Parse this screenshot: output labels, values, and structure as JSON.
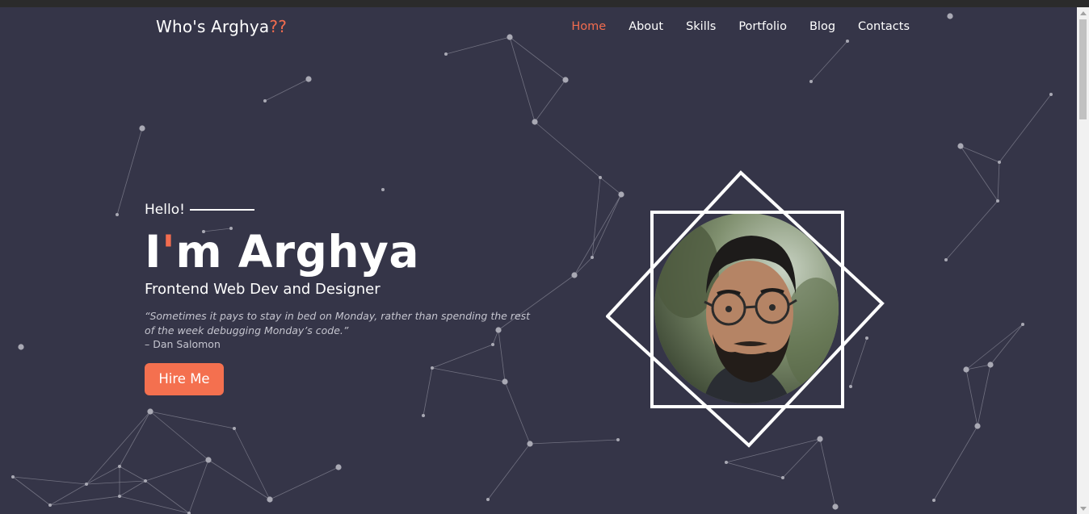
{
  "brand": {
    "name": "Who's Arghya",
    "accent": "??"
  },
  "nav": {
    "items": [
      {
        "label": "Home",
        "active": true
      },
      {
        "label": "About",
        "active": false
      },
      {
        "label": "Skills",
        "active": false
      },
      {
        "label": "Portfolio",
        "active": false
      },
      {
        "label": "Blog",
        "active": false
      },
      {
        "label": "Contacts",
        "active": false
      }
    ]
  },
  "hero": {
    "greeting": "Hello!",
    "name_prefix": "I",
    "name_apostrophe": "'",
    "name_rest": "m Arghya",
    "role": "Frontend Web Dev and Designer",
    "quote": "“Sometimes it pays to stay in bed on Monday, rather than spending the rest of the week debugging Monday’s code.”",
    "author": "– Dan Salomon",
    "cta_label": "Hire Me"
  },
  "colors": {
    "background": "#353548",
    "accent": "#f26c4f",
    "button": "#f4704f",
    "text": "#ffffff"
  },
  "icons": {
    "portrait": "profile-photo",
    "frame": "double-square-frame"
  }
}
